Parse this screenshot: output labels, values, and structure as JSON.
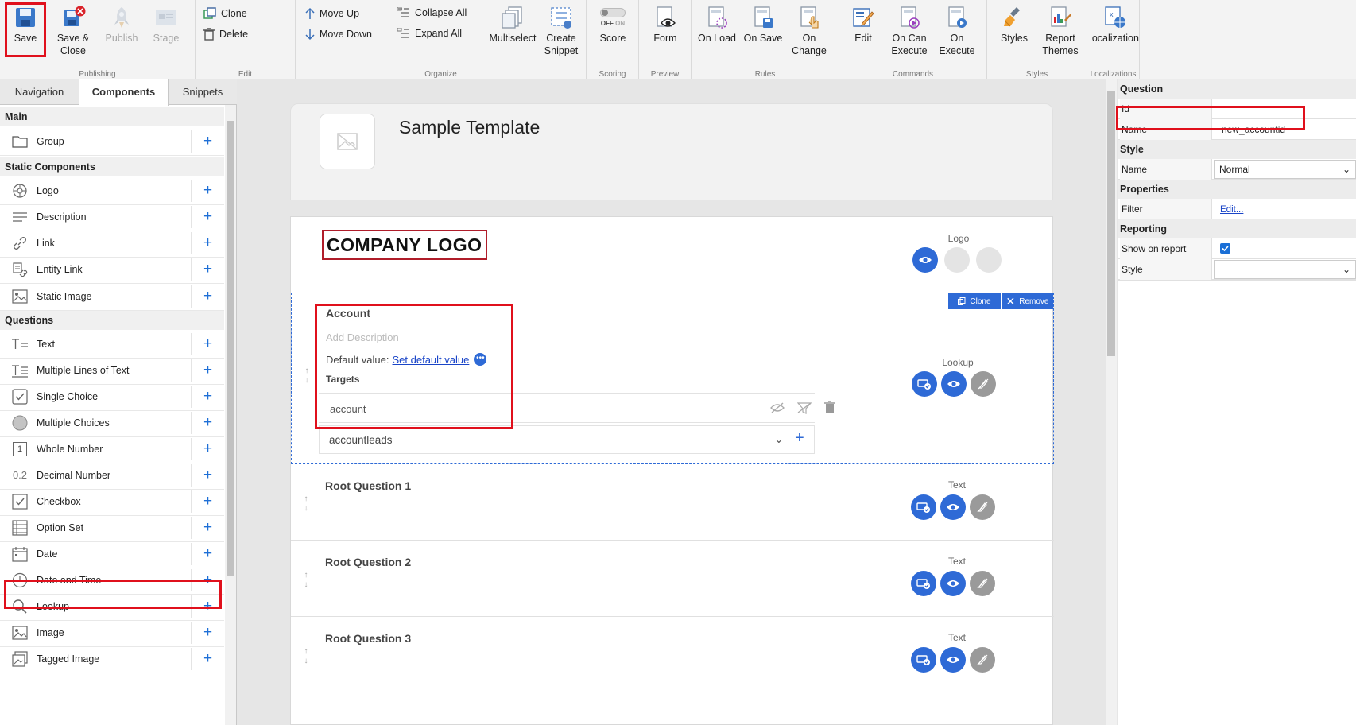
{
  "ribbon": {
    "groups": {
      "publishing": "Publishing",
      "edit": "Edit",
      "organize": "Organize",
      "scoring": "Scoring",
      "preview": "Preview",
      "rules": "Rules",
      "commands": "Commands",
      "styles": "Styles",
      "localizations": "Localizations"
    },
    "save": "Save",
    "save_close_1": "Save &",
    "save_close_2": "Close",
    "publish": "Publish",
    "stage": "Stage",
    "clone": "Clone",
    "delete": "Delete",
    "move_up": "Move Up",
    "move_down": "Move Down",
    "collapse_all": "Collapse All",
    "expand_all": "Expand All",
    "multiselect": "Multiselect",
    "create_snippet_1": "Create",
    "create_snippet_2": "Snippet",
    "toggle_off": "OFF",
    "toggle_on": "ON",
    "score": "Score",
    "form": "Form",
    "on_load": "On Load",
    "on_save": "On Save",
    "on_change_1": "On",
    "on_change_2": "Change",
    "edit_cmd": "Edit",
    "on_can_execute_1": "On Can",
    "on_can_execute_2": "Execute",
    "on_execute_1": "On",
    "on_execute_2": "Execute",
    "styles_btn": "Styles",
    "report_themes_1": "Report",
    "report_themes_2": "Themes",
    "localizations_btn": "Localizations"
  },
  "left_panel": {
    "tabs": [
      "Navigation",
      "Components",
      "Snippets"
    ],
    "sections": {
      "main": "Main",
      "static": "Static Components",
      "questions": "Questions"
    },
    "main_items": [
      "Group"
    ],
    "static_items": [
      "Logo",
      "Description",
      "Link",
      "Entity Link",
      "Static Image"
    ],
    "question_items": [
      "Text",
      "Multiple Lines of Text",
      "Single Choice",
      "Multiple Choices",
      "Whole Number",
      "Decimal Number",
      "Checkbox",
      "Option Set",
      "Date",
      "Date and Time",
      "Lookup",
      "Image",
      "Tagged Image"
    ],
    "decimal_icon_text": "0.2",
    "whole_icon_text": "1"
  },
  "canvas": {
    "template_title": "Sample Template",
    "logo_text": "COMPANY LOGO",
    "logo_type": "Logo",
    "account": {
      "title": "Account",
      "add_description": "Add Description",
      "default_label": "Default value:",
      "default_link": "Set default value",
      "targets_label": "Targets",
      "target_value": "account",
      "dropdown_value": "accountleads",
      "type": "Lookup",
      "clone": "Clone",
      "remove": "Remove"
    },
    "root_questions": [
      {
        "title": "Root Question 1",
        "type": "Text"
      },
      {
        "title": "Root Question 2",
        "type": "Text"
      },
      {
        "title": "Root Question 3",
        "type": "Text"
      }
    ]
  },
  "right_panel": {
    "sections": {
      "question": "Question",
      "style": "Style",
      "properties": "Properties",
      "reporting": "Reporting"
    },
    "id_label": "Id",
    "id_value": "",
    "name_label": "Name",
    "name_value": "new_accountid",
    "style_name_label": "Name",
    "style_name_value": "Normal",
    "filter_label": "Filter",
    "filter_value": "Edit...",
    "show_on_report_label": "Show on report",
    "show_on_report": true,
    "report_style_label": "Style",
    "report_style_value": ""
  },
  "colors": {
    "accent_blue": "#2e6ad6",
    "highlight_red": "#e0101c",
    "selection_dashed": "#2e6ad6",
    "save_icon": "#3a78c9"
  }
}
